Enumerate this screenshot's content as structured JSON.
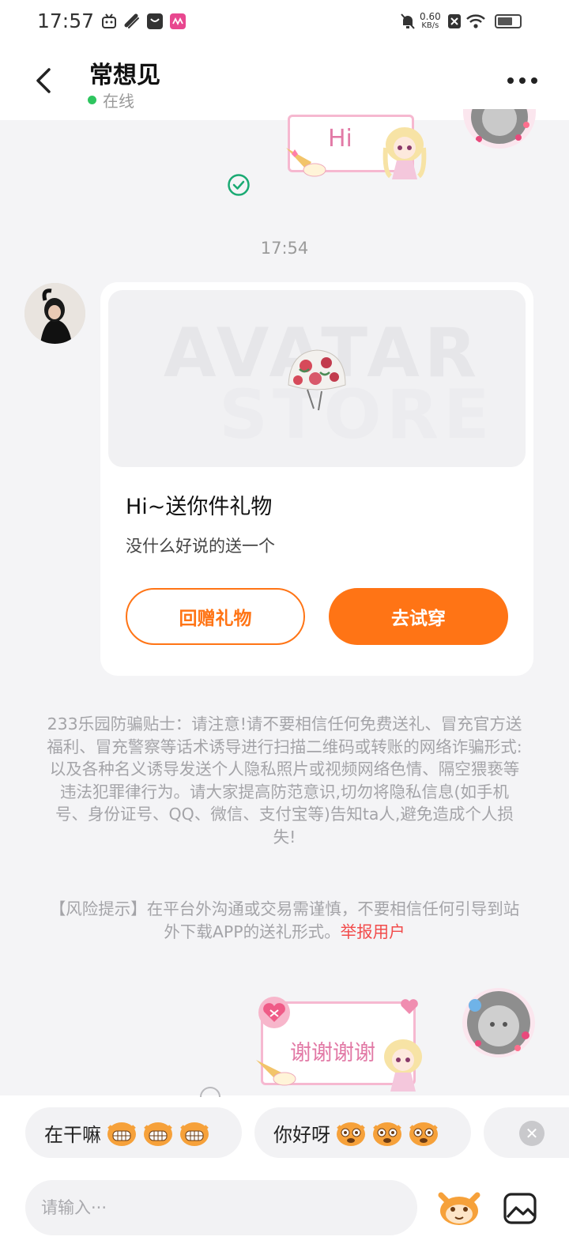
{
  "status_bar": {
    "time": "17:57",
    "net_speed_value": "0.60",
    "net_speed_unit": "KB/s",
    "icons": [
      "app-notification-icon",
      "link-icon",
      "shop-icon",
      "music-icon",
      "mute-bell-icon",
      "sim-off-icon",
      "wifi-icon",
      "battery-icon"
    ],
    "battery_level": 0.7
  },
  "header": {
    "title": "常想见",
    "status": "在线",
    "status_color": "#2ec55f"
  },
  "messages": {
    "sticker_hi_text": "Hi",
    "timestamp": "17:54",
    "gift": {
      "title": "Hi~送你件礼物",
      "subtitle": "没什么好说的送一个",
      "return_button": "回赠礼物",
      "try_button": "去试穿",
      "watermark_line1": "AVATAR",
      "watermark_line2": "STORE"
    },
    "notice": "233乐园防骗贴士：请注意!请不要相信任何免费送礼、冒充官方送福利、冒充警察等话术诱导进行扫描二维码或转账的网络诈骗形式:以及各种名义诱导发送个人隐私照片或视频网络色情、隔空猥亵等违法犯罪律行为。请大家提高防范意识,切勿将隐私信息(如手机号、身份证号、QQ、微信、支付宝等)告知ta人,避免造成个人损失!",
    "risk_text": "【风险提示】在平台外沟通或交易需谨慎，不要相信任何引导到站外下载APP的送礼形式。",
    "risk_link": "举报用户",
    "sticker_thanks_text": "谢谢谢谢"
  },
  "quick_replies": [
    {
      "label": "在干嘛"
    },
    {
      "label": "你好呀"
    }
  ],
  "input": {
    "placeholder": "请输入···"
  },
  "colors": {
    "accent": "#ff7415",
    "report": "#f24b4b",
    "sticker_pink": "#e27aa6"
  }
}
